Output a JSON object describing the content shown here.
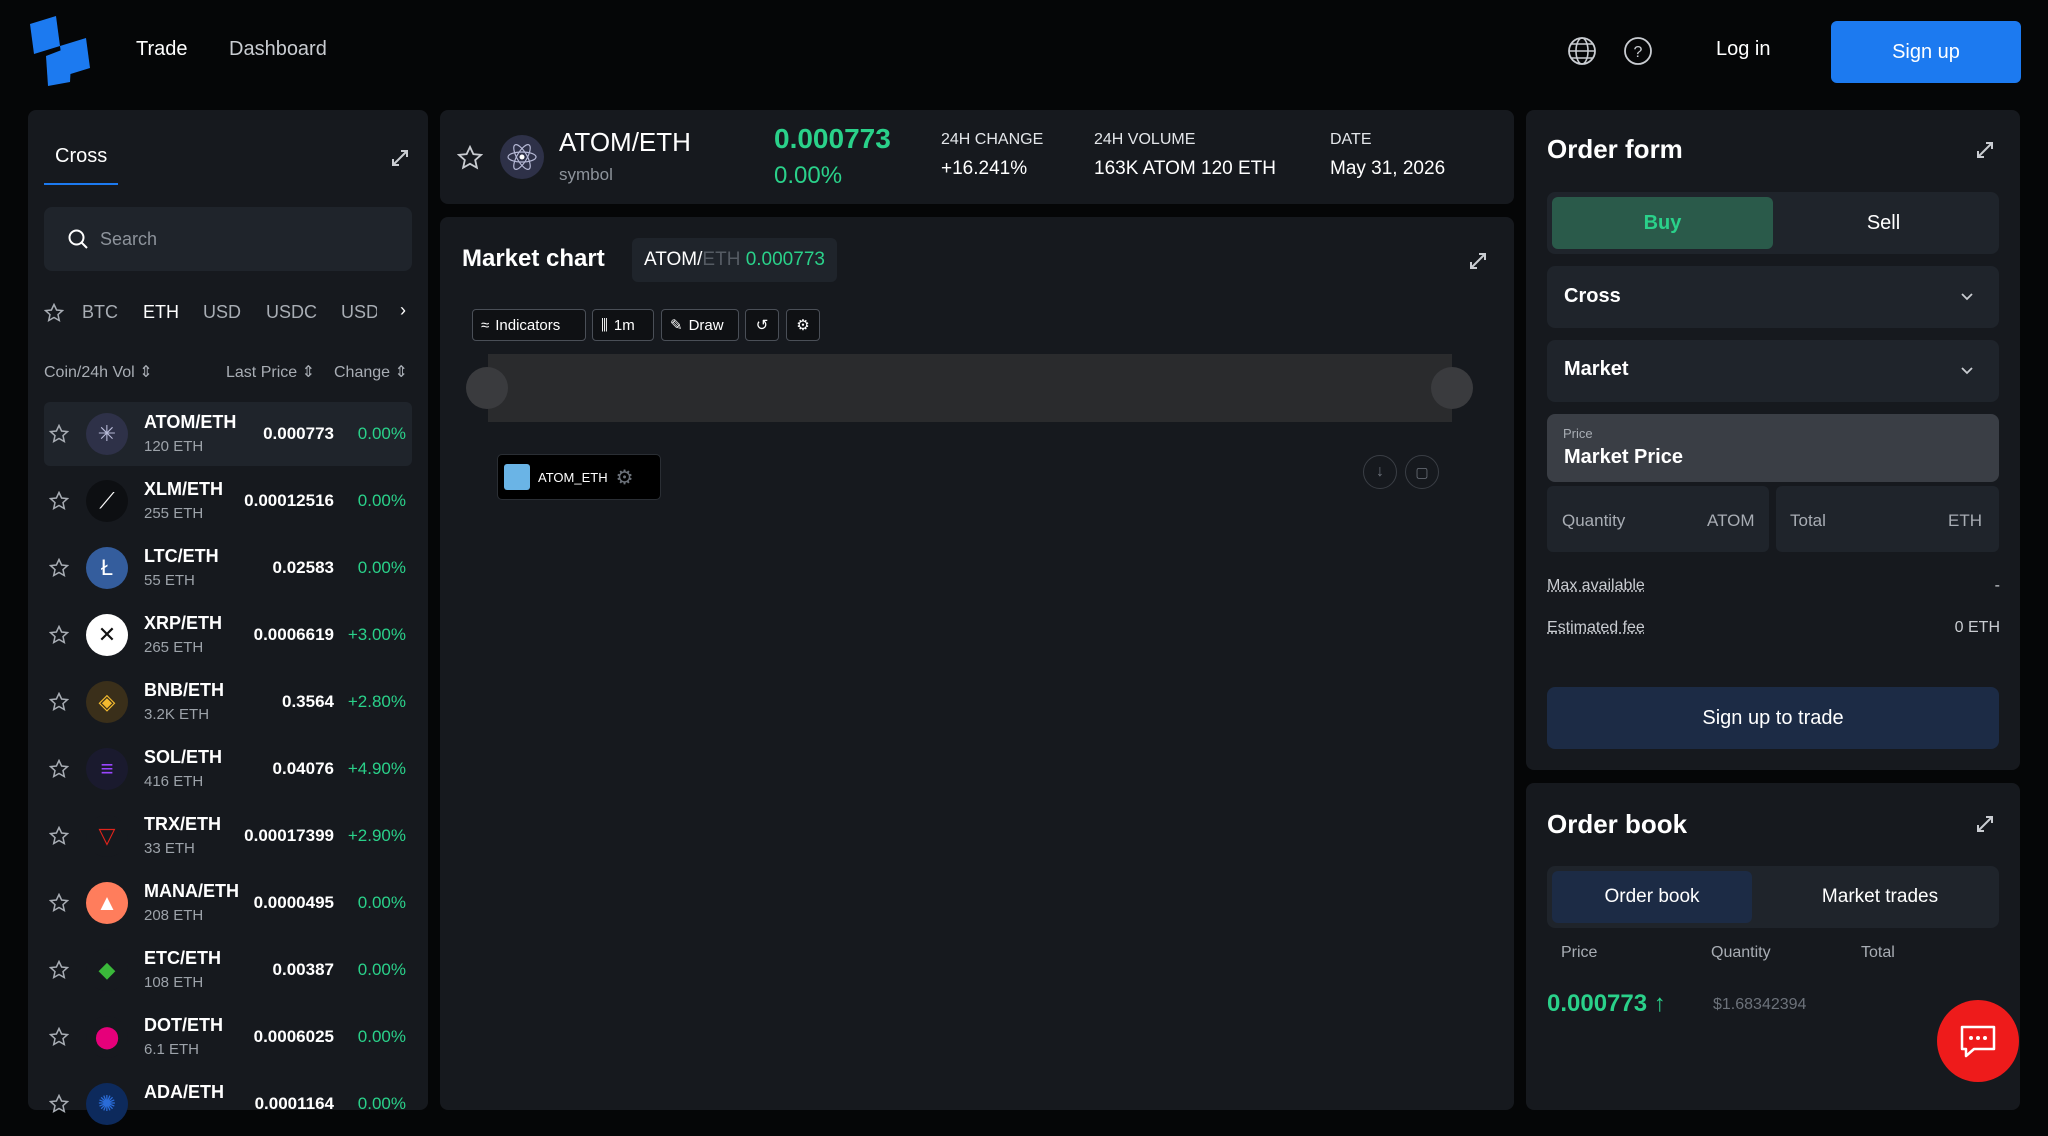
{
  "header": {
    "nav": [
      "Trade",
      "Dashboard"
    ],
    "login": "Log in",
    "signup": "Sign up"
  },
  "markets": {
    "tab": "Cross",
    "search_placeholder": "Search",
    "quotes": [
      "BTC",
      "ETH",
      "USD",
      "USDC",
      "USD"
    ],
    "active_quote": "ETH",
    "columns": [
      "Coin/24h Vol",
      "Last Price",
      "Change"
    ],
    "rows": [
      {
        "pair": "ATOM/ETH",
        "vol": "120 ETH",
        "price": "0.000773",
        "change": "0.00%",
        "icon": "atom-icon"
      },
      {
        "pair": "XLM/ETH",
        "vol": "255 ETH",
        "price": "0.00012516",
        "change": "0.00%",
        "icon": "xlm-icon"
      },
      {
        "pair": "LTC/ETH",
        "vol": "55 ETH",
        "price": "0.02583",
        "change": "0.00%",
        "icon": "ltc-icon"
      },
      {
        "pair": "XRP/ETH",
        "vol": "265 ETH",
        "price": "0.0006619",
        "change": "+3.00%",
        "icon": "xrp-icon"
      },
      {
        "pair": "BNB/ETH",
        "vol": "3.2K ETH",
        "price": "0.3564",
        "change": "+2.80%",
        "icon": "bnb-icon"
      },
      {
        "pair": "SOL/ETH",
        "vol": "416 ETH",
        "price": "0.04076",
        "change": "+4.90%",
        "icon": "sol-icon"
      },
      {
        "pair": "TRX/ETH",
        "vol": "33 ETH",
        "price": "0.00017399",
        "change": "+2.90%",
        "icon": "trx-icon"
      },
      {
        "pair": "MANA/ETH",
        "vol": "208 ETH",
        "price": "0.0000495",
        "change": "0.00%",
        "icon": "mana-icon"
      },
      {
        "pair": "ETC/ETH",
        "vol": "108 ETH",
        "price": "0.00387",
        "change": "0.00%",
        "icon": "etc-icon"
      },
      {
        "pair": "DOT/ETH",
        "vol": "6.1 ETH",
        "price": "0.0006025",
        "change": "0.00%",
        "icon": "dot-icon"
      },
      {
        "pair": "ADA/ETH",
        "vol": "",
        "price": "0.0001164",
        "change": "0.00%",
        "icon": "ada-icon"
      }
    ]
  },
  "ticker": {
    "symbol": "ATOM/ETH",
    "sub": "symbol",
    "price": "0.000773",
    "pct": "0.00%",
    "change_label": "24H CHANGE",
    "change_value": "+16.241%",
    "volume_label": "24H VOLUME",
    "volume_value": "163K ATOM 120 ETH",
    "date_label": "DATE",
    "date_value": "May 31, 2026"
  },
  "chart": {
    "title": "Market chart",
    "badge_pair_a": "ATOM/",
    "badge_pair_b": "ETH",
    "badge_price": "0.000773",
    "tools": {
      "indicators": "Indicators",
      "interval": "1m",
      "draw": "Draw"
    },
    "legend": "ATOM_ETH"
  },
  "order_form": {
    "title": "Order form",
    "buy": "Buy",
    "sell": "Sell",
    "margin_mode": "Cross",
    "order_type": "Market",
    "price_label": "Price",
    "price_value": "Market Price",
    "qty_label": "Quantity",
    "qty_unit": "ATOM",
    "total_label": "Total",
    "total_unit": "ETH",
    "max_label": "Max available",
    "max_value": "-",
    "fee_label": "Estimated fee",
    "fee_value": "0 ETH",
    "cta": "Sign up to trade"
  },
  "order_book": {
    "title": "Order book",
    "tabs": [
      "Order book",
      "Market trades"
    ],
    "columns": [
      "Price",
      "Quantity",
      "Total"
    ],
    "last_price": "0.000773",
    "last_usd": "$1.68342394"
  },
  "colors": {
    "accent": "#1c7af0",
    "positive": "#2ad18a",
    "panel": "#16191e",
    "chat": "#ee1b1b"
  }
}
